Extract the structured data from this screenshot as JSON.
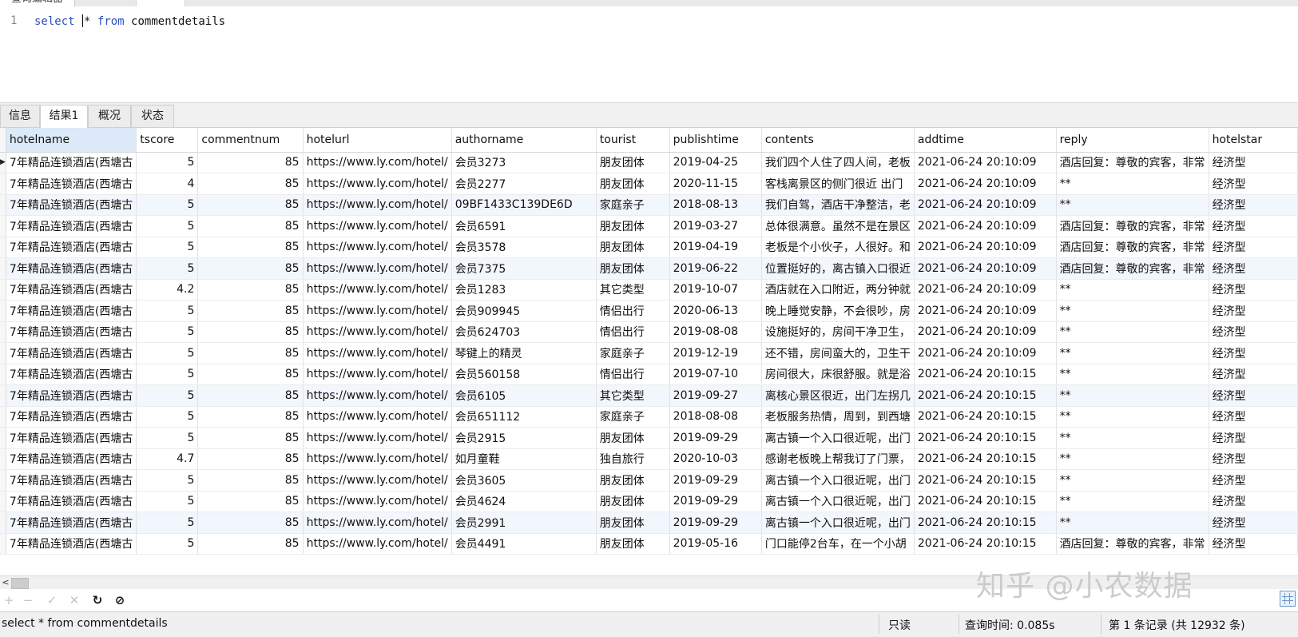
{
  "top_tab": "查询编辑器",
  "editor": {
    "line_number": "1",
    "kw_select": "select",
    "star": "*",
    "kw_from": "from",
    "table_name": "commentdetails"
  },
  "result_tabs": [
    "信息",
    "结果1",
    "概况",
    "状态"
  ],
  "grid": {
    "columns": [
      "hotelname",
      "tscore",
      "commentnum",
      "hotelurl",
      "authorname",
      "tourist",
      "publishtime",
      "contents",
      "addtime",
      "reply",
      "hotelstar"
    ],
    "rows": [
      [
        "7年精品连锁酒店(西塘古",
        "5",
        "85",
        "https://www.ly.com/hotel/",
        "会员3273",
        "朋友团体",
        "2019-04-25",
        "我们四个人住了四人间，老板",
        "2021-06-24 20:10:09",
        "酒店回复：尊敬的宾客，非常",
        "经济型"
      ],
      [
        "7年精品连锁酒店(西塘古",
        "4",
        "85",
        "https://www.ly.com/hotel/",
        "会员2277",
        "朋友团体",
        "2020-11-15",
        "客栈离景区的侧门很近 出门",
        "2021-06-24 20:10:09",
        "**",
        "经济型"
      ],
      [
        "7年精品连锁酒店(西塘古",
        "5",
        "85",
        "https://www.ly.com/hotel/",
        "09BF1433C139DE6D",
        "家庭亲子",
        "2018-08-13",
        "我们自驾，酒店干净整洁，老",
        "2021-06-24 20:10:09",
        "**",
        "经济型"
      ],
      [
        "7年精品连锁酒店(西塘古",
        "5",
        "85",
        "https://www.ly.com/hotel/",
        "会员6591",
        "朋友团体",
        "2019-03-27",
        "总体很满意。虽然不是在景区",
        "2021-06-24 20:10:09",
        "酒店回复：尊敬的宾客，非常",
        "经济型"
      ],
      [
        "7年精品连锁酒店(西塘古",
        "5",
        "85",
        "https://www.ly.com/hotel/",
        "会员3578",
        "朋友团体",
        "2019-04-19",
        "老板是个小伙子，人很好。和",
        "2021-06-24 20:10:09",
        "酒店回复：尊敬的宾客，非常",
        "经济型"
      ],
      [
        "7年精品连锁酒店(西塘古",
        "5",
        "85",
        "https://www.ly.com/hotel/",
        "会员7375",
        "朋友团体",
        "2019-06-22",
        "位置挺好的，离古镇入口很近",
        "2021-06-24 20:10:09",
        "酒店回复：尊敬的宾客，非常",
        "经济型"
      ],
      [
        "7年精品连锁酒店(西塘古",
        "4.2",
        "85",
        "https://www.ly.com/hotel/",
        "会员1283",
        "其它类型",
        "2019-10-07",
        "酒店就在入口附近，两分钟就",
        "2021-06-24 20:10:09",
        "**",
        "经济型"
      ],
      [
        "7年精品连锁酒店(西塘古",
        "5",
        "85",
        "https://www.ly.com/hotel/",
        "会员909945",
        "情侣出行",
        "2020-06-13",
        "晚上睡觉安静，不会很吵，房",
        "2021-06-24 20:10:09",
        "**",
        "经济型"
      ],
      [
        "7年精品连锁酒店(西塘古",
        "5",
        "85",
        "https://www.ly.com/hotel/",
        "会员624703",
        "情侣出行",
        "2019-08-08",
        "设施挺好的，房间干净卫生，",
        "2021-06-24 20:10:09",
        "**",
        "经济型"
      ],
      [
        "7年精品连锁酒店(西塘古",
        "5",
        "85",
        "https://www.ly.com/hotel/",
        "琴键上的精灵",
        "家庭亲子",
        "2019-12-19",
        "还不错，房间蛮大的，卫生干",
        "2021-06-24 20:10:09",
        "**",
        "经济型"
      ],
      [
        "7年精品连锁酒店(西塘古",
        "5",
        "85",
        "https://www.ly.com/hotel/",
        "会员560158",
        "情侣出行",
        "2019-07-10",
        "房间很大，床很舒服。就是浴",
        "2021-06-24 20:10:15",
        "**",
        "经济型"
      ],
      [
        "7年精品连锁酒店(西塘古",
        "5",
        "85",
        "https://www.ly.com/hotel/",
        "会员6105",
        "其它类型",
        "2019-09-27",
        "离核心景区很近，出门左拐几",
        "2021-06-24 20:10:15",
        "**",
        "经济型"
      ],
      [
        "7年精品连锁酒店(西塘古",
        "5",
        "85",
        "https://www.ly.com/hotel/",
        "会员651112",
        "家庭亲子",
        "2018-08-08",
        "老板服务热情，周到，到西塘",
        "2021-06-24 20:10:15",
        "**",
        "经济型"
      ],
      [
        "7年精品连锁酒店(西塘古",
        "5",
        "85",
        "https://www.ly.com/hotel/",
        "会员2915",
        "朋友团体",
        "2019-09-29",
        "离古镇一个入口很近呢，出门",
        "2021-06-24 20:10:15",
        "**",
        "经济型"
      ],
      [
        "7年精品连锁酒店(西塘古",
        "4.7",
        "85",
        "https://www.ly.com/hotel/",
        "如月童鞋",
        "独自旅行",
        "2020-10-03",
        "感谢老板晚上帮我订了门票，",
        "2021-06-24 20:10:15",
        "**",
        "经济型"
      ],
      [
        "7年精品连锁酒店(西塘古",
        "5",
        "85",
        "https://www.ly.com/hotel/",
        "会员3605",
        "朋友团体",
        "2019-09-29",
        "离古镇一个入口很近呢，出门",
        "2021-06-24 20:10:15",
        "**",
        "经济型"
      ],
      [
        "7年精品连锁酒店(西塘古",
        "5",
        "85",
        "https://www.ly.com/hotel/",
        "会员4624",
        "朋友团体",
        "2019-09-29",
        "离古镇一个入口很近呢，出门",
        "2021-06-24 20:10:15",
        "**",
        "经济型"
      ],
      [
        "7年精品连锁酒店(西塘古",
        "5",
        "85",
        "https://www.ly.com/hotel/",
        "会员2991",
        "朋友团体",
        "2019-09-29",
        "离古镇一个入口很近呢，出门",
        "2021-06-24 20:10:15",
        "**",
        "经济型"
      ],
      [
        "7年精品连锁酒店(西塘古",
        "5",
        "85",
        "https://www.ly.com/hotel/",
        "会员4491",
        "朋友团体",
        "2019-05-16",
        "门口能停2台车，在一个小胡",
        "2021-06-24 20:10:15",
        "酒店回复：尊敬的宾客，非常",
        "经济型"
      ]
    ]
  },
  "toolbar": {
    "add": "+",
    "remove": "−",
    "apply": "✓",
    "discard": "✕",
    "refresh": "↻",
    "stop": "⊘"
  },
  "watermark": "知乎 @小农数据",
  "status": {
    "query": "select * from commentdetails",
    "mode": "只读",
    "query_time": "查询时间: 0.085s",
    "record": "第 1 条记录 (共 12932 条)"
  }
}
